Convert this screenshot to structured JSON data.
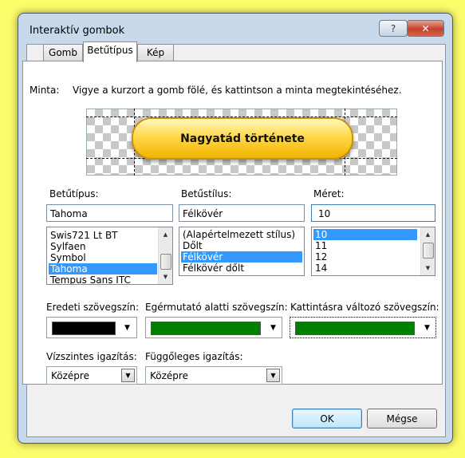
{
  "dialog": {
    "title": "Interaktív gombok",
    "help_glyph": "?",
    "close_glyph": "✕"
  },
  "tabs": [
    {
      "label": "Gomb",
      "active": false
    },
    {
      "label": "Betűtípus",
      "active": true
    },
    {
      "label": "Kép",
      "active": false
    }
  ],
  "preview": {
    "label": "Minta:",
    "hint": "Vigye a kurzort a gomb fölé, és kattintson a minta megtekintéséhez.",
    "button_text": "Nagyatád története"
  },
  "font": {
    "label": "Betűtípus:",
    "value": "Tahoma",
    "options": [
      "Swis721 Lt BT",
      "Sylfaen",
      "Symbol",
      "Tahoma",
      "Tempus Sans ITC"
    ],
    "selected": "Tahoma"
  },
  "style": {
    "label": "Betűstílus:",
    "value": "Félkövér",
    "options": [
      "(Alapértelmezett stílus)",
      "Dőlt",
      "Félkövér",
      "Félkövér dőlt"
    ],
    "selected": "Félkövér"
  },
  "size": {
    "label": "Méret:",
    "value": "10",
    "options": [
      "10",
      "11",
      "12",
      "14"
    ],
    "selected": "10"
  },
  "colors": {
    "original": {
      "label": "Eredeti szövegszín:",
      "color": "#000000"
    },
    "hover": {
      "label": "Egérmutató alatti szövegszín:",
      "color": "#008000"
    },
    "click": {
      "label": "Kattintásra változó szövegszín:",
      "color": "#008000"
    }
  },
  "alignment": {
    "horizontal": {
      "label": "Vízszintes igazítás:",
      "value": "Középre"
    },
    "vertical": {
      "label": "Függőleges igazítás:",
      "value": "Középre"
    }
  },
  "buttons": {
    "ok": "OK",
    "cancel": "Mégse"
  },
  "icons": {
    "dropdown": "▼",
    "scroll_up": "▲",
    "scroll_down": "▼"
  }
}
